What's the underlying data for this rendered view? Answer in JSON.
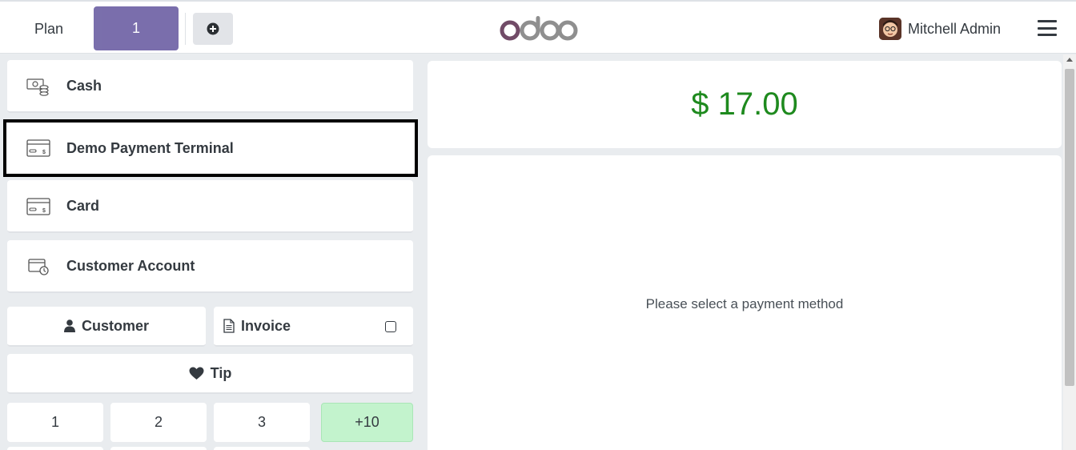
{
  "header": {
    "plan_label": "Plan",
    "order_tab_label": "1",
    "logo_text": "odoo",
    "user_name": "Mitchell Admin"
  },
  "payment_methods": [
    {
      "label": "Cash",
      "icon": "cash-icon"
    },
    {
      "label": "Demo Payment Terminal",
      "icon": "card-terminal-icon",
      "selected": true
    },
    {
      "label": "Card",
      "icon": "card-icon"
    },
    {
      "label": "Customer Account",
      "icon": "customer-account-icon"
    }
  ],
  "actions": {
    "customer_label": "Customer",
    "invoice_label": "Invoice",
    "invoice_checked": false,
    "tip_label": "Tip"
  },
  "numpad": {
    "keys": [
      "1",
      "2",
      "3",
      "+10"
    ]
  },
  "summary": {
    "total": "$ 17.00",
    "message": "Please select a payment method"
  },
  "colors": {
    "accent": "#7367a8",
    "total_green": "#1e8a1e",
    "plus_key": "#c3f3cd"
  }
}
